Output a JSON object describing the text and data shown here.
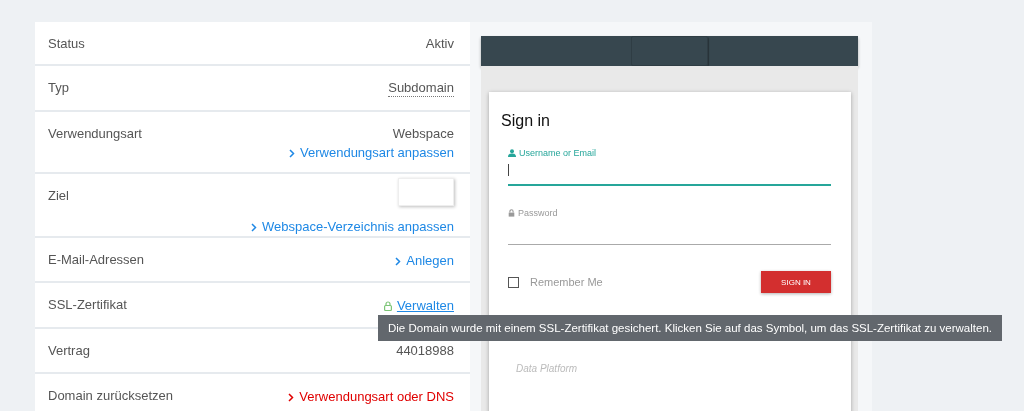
{
  "details": {
    "rows": [
      {
        "kind": "text",
        "label": "Status",
        "value": "Aktiv"
      },
      {
        "kind": "abbr",
        "label": "Typ",
        "value": "Subdomain"
      },
      {
        "kind": "text_link",
        "label": "Verwendungsart",
        "value": "Webspace",
        "link": "Verwendungsart anpassen"
      },
      {
        "kind": "thumb_link",
        "label": "Ziel",
        "link": "Webspace-Verzeichnis anpassen"
      },
      {
        "kind": "link",
        "label": "E-Mail-Adressen",
        "link": "Anlegen"
      },
      {
        "kind": "ssl",
        "label": "SSL-Zertifikat",
        "link": "Verwalten"
      },
      {
        "kind": "text",
        "label": "Vertrag",
        "value": "44018988"
      },
      {
        "kind": "danger",
        "label": "Domain zurücksetzen",
        "link": "Verwendungsart oder DNS"
      }
    ]
  },
  "tooltip": {
    "text": "Die Domain wurde mit einem SSL-Zertifikat gesichert. Klicken Sie auf das Symbol, um das SSL-Zertifikat zu verwalten."
  },
  "preview": {
    "title": "Sign in",
    "fields": [
      {
        "kind": "user",
        "label": "Username or Email",
        "focused": true
      },
      {
        "kind": "lock",
        "label": "Password",
        "focused": false
      }
    ],
    "remember": {
      "label": "Remember Me",
      "checked": false
    },
    "button": "SIGN IN",
    "footer": "Data Platform"
  }
}
